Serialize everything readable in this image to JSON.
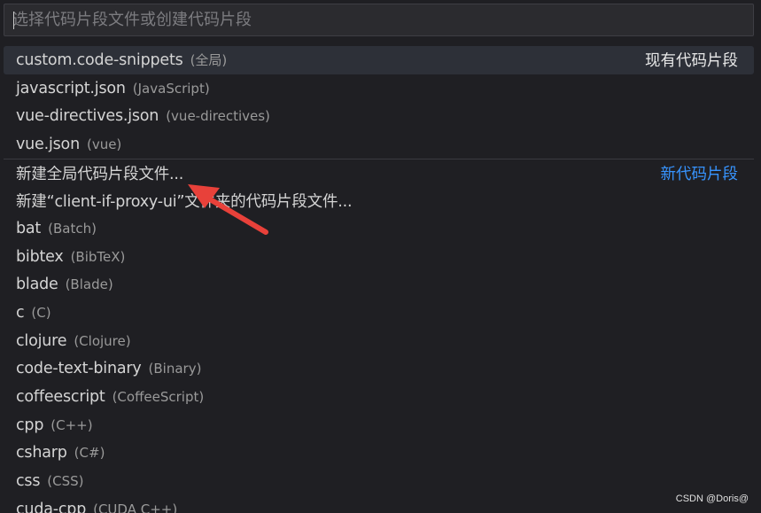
{
  "search": {
    "placeholder": "选择代码片段文件或创建代码片段"
  },
  "groups": {
    "existing_label": "现有代码片段",
    "new_label": "新代码片段"
  },
  "existing_items": [
    {
      "label": "custom.code-snippets",
      "desc": "(全局)"
    },
    {
      "label": "javascript.json",
      "desc": "(JavaScript)"
    },
    {
      "label": "vue-directives.json",
      "desc": "(vue-directives)"
    },
    {
      "label": "vue.json",
      "desc": "(vue)"
    }
  ],
  "new_items": [
    {
      "label": "新建全局代码片段文件...",
      "desc": ""
    },
    {
      "label": "新建“client-if-proxy-ui”文件夹的代码片段文件...",
      "desc": ""
    },
    {
      "label": "bat",
      "desc": "(Batch)"
    },
    {
      "label": "bibtex",
      "desc": "(BibTeX)"
    },
    {
      "label": "blade",
      "desc": "(Blade)"
    },
    {
      "label": "c",
      "desc": "(C)"
    },
    {
      "label": "clojure",
      "desc": "(Clojure)"
    },
    {
      "label": "code-text-binary",
      "desc": "(Binary)"
    },
    {
      "label": "coffeescript",
      "desc": "(CoffeeScript)"
    },
    {
      "label": "cpp",
      "desc": "(C++)"
    },
    {
      "label": "csharp",
      "desc": "(C#)"
    },
    {
      "label": "css",
      "desc": "(CSS)"
    },
    {
      "label": "cuda-cpp",
      "desc": "(CUDA C++)"
    }
  ],
  "watermark": "CSDN @Doris@",
  "colors": {
    "background": "#1f1f23",
    "selected_row": "#2d3038",
    "accent_blue": "#3794ff",
    "annotation_arrow": "#e8413a"
  }
}
